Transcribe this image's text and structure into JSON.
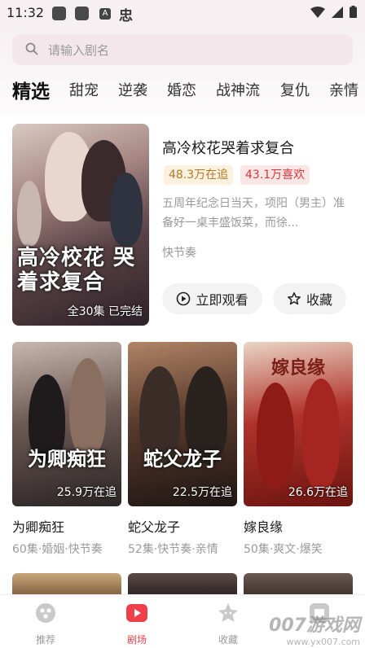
{
  "status_bar": {
    "time": "11:32",
    "carrier_glyph": "忠",
    "notification_glyph": "A"
  },
  "search": {
    "placeholder": "请输入剧名"
  },
  "tabs": [
    {
      "label": "精选",
      "active": true
    },
    {
      "label": "甜宠"
    },
    {
      "label": "逆袭"
    },
    {
      "label": "婚恋"
    },
    {
      "label": "战神流"
    },
    {
      "label": "复仇"
    },
    {
      "label": "亲情"
    }
  ],
  "featured": {
    "title": "高冷校花哭着求复合",
    "poster_art_title": "高冷校花 哭着求复合",
    "status": "全30集 已完结",
    "follow_count": "48.3万在追",
    "like_count": "43.1万喜欢",
    "description": "五周年纪念日当天，项阳（男主）准备好一桌丰盛饭菜，而徐...",
    "source": "快节奏",
    "watch_button": "立即观看",
    "collect_button": "收藏"
  },
  "grid": [
    {
      "title": "为卿痴狂",
      "art_title": "为卿痴狂",
      "follow": "25.9万在追",
      "meta": "60集·婚姻·快节奏"
    },
    {
      "title": "蛇父龙子",
      "art_title": "蛇父龙子",
      "follow": "22.5万在追",
      "meta": "52集·快节奏·亲情"
    },
    {
      "title": "嫁良缘",
      "art_title": "嫁良缘",
      "follow": "26.6万在追",
      "meta": "50集·爽文·爆笑"
    }
  ],
  "bottom_nav": [
    {
      "label": "推荐",
      "icon": "recommend-icon"
    },
    {
      "label": "剧场",
      "icon": "theater-play-icon",
      "active": true
    },
    {
      "label": "收藏",
      "icon": "star-collect-icon"
    },
    {
      "label": "我的",
      "icon": "profile-icon"
    }
  ],
  "watermark": {
    "main": "007游戏网",
    "sub": "www.yx007.com"
  },
  "colors": {
    "accent": "#ef3f4a",
    "follow_badge_text": "#b07b2a",
    "like_badge_text": "#d3383b"
  }
}
